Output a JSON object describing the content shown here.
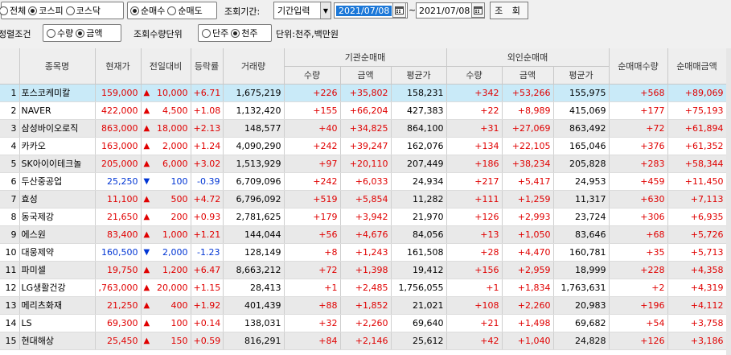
{
  "toolbar": {
    "market_filter": [
      {
        "label": "전체",
        "selected": false
      },
      {
        "label": "코스피",
        "selected": true
      },
      {
        "label": "코스닥",
        "selected": false
      }
    ],
    "trade_type": [
      {
        "label": "순매수",
        "selected": true
      },
      {
        "label": "순매도",
        "selected": false
      }
    ],
    "period_label": "조회기간:",
    "period_select": "기간입력",
    "date_from": "2021/07/08",
    "date_sep": "~",
    "date_to": "2021/07/08",
    "query_button": "조 회",
    "sort_label": "정렬조건",
    "sort_options": [
      {
        "label": "수량",
        "selected": false
      },
      {
        "label": "금액",
        "selected": true
      }
    ],
    "unit_label": "조회수량단위",
    "unit_options": [
      {
        "label": "단주",
        "selected": false
      },
      {
        "label": "천주",
        "selected": true
      }
    ],
    "unit_note": "단위:천주,백만원"
  },
  "table": {
    "group_headers": {
      "institution": "기관순매매",
      "foreign": "외인순매매"
    },
    "headers": {
      "name": "종목명",
      "price": "현재가",
      "change": "전일대비",
      "rate": "등락률",
      "volume": "거래량",
      "inst_qty": "수량",
      "inst_amt": "금액",
      "inst_avg": "평균가",
      "frgn_qty": "수량",
      "frgn_amt": "금액",
      "frgn_avg": "평균가",
      "net_qty": "순매매수량",
      "net_amt": "순매매금액"
    },
    "rows": [
      {
        "idx": "1",
        "name": "포스코케미칼",
        "price": "159,000",
        "dir": "up",
        "change": "10,000",
        "rate": "+6.71",
        "volume": "1,675,219",
        "inst_qty": "+226",
        "inst_amt": "+35,802",
        "inst_avg": "158,231",
        "frgn_qty": "+342",
        "frgn_amt": "+53,266",
        "frgn_avg": "155,975",
        "net_qty": "+568",
        "net_amt": "+89,069"
      },
      {
        "idx": "2",
        "name": "NAVER",
        "price": "422,000",
        "dir": "up",
        "change": "4,500",
        "rate": "+1.08",
        "volume": "1,132,420",
        "inst_qty": "+155",
        "inst_amt": "+66,204",
        "inst_avg": "427,383",
        "frgn_qty": "+22",
        "frgn_amt": "+8,989",
        "frgn_avg": "415,069",
        "net_qty": "+177",
        "net_amt": "+75,193"
      },
      {
        "idx": "3",
        "name": "삼성바이오로직",
        "price": "863,000",
        "dir": "up",
        "change": "18,000",
        "rate": "+2.13",
        "volume": "148,577",
        "inst_qty": "+40",
        "inst_amt": "+34,825",
        "inst_avg": "864,100",
        "frgn_qty": "+31",
        "frgn_amt": "+27,069",
        "frgn_avg": "863,492",
        "net_qty": "+72",
        "net_amt": "+61,894"
      },
      {
        "idx": "4",
        "name": "카카오",
        "price": "163,000",
        "dir": "up",
        "change": "2,000",
        "rate": "+1.24",
        "volume": "4,090,290",
        "inst_qty": "+242",
        "inst_amt": "+39,247",
        "inst_avg": "162,076",
        "frgn_qty": "+134",
        "frgn_amt": "+22,105",
        "frgn_avg": "165,046",
        "net_qty": "+376",
        "net_amt": "+61,352"
      },
      {
        "idx": "5",
        "name": "SK아이이테크놀",
        "price": "205,000",
        "dir": "up",
        "change": "6,000",
        "rate": "+3.02",
        "volume": "1,513,929",
        "inst_qty": "+97",
        "inst_amt": "+20,110",
        "inst_avg": "207,449",
        "frgn_qty": "+186",
        "frgn_amt": "+38,234",
        "frgn_avg": "205,828",
        "net_qty": "+283",
        "net_amt": "+58,344"
      },
      {
        "idx": "6",
        "name": "두산중공업",
        "price": "25,250",
        "dir": "dn",
        "change": "100",
        "rate": "-0.39",
        "volume": "6,709,096",
        "inst_qty": "+242",
        "inst_amt": "+6,033",
        "inst_avg": "24,934",
        "frgn_qty": "+217",
        "frgn_amt": "+5,417",
        "frgn_avg": "24,953",
        "net_qty": "+459",
        "net_amt": "+11,450"
      },
      {
        "idx": "7",
        "name": "효성",
        "price": "11,100",
        "dir": "up",
        "change": "500",
        "rate": "+4.72",
        "volume": "6,796,092",
        "inst_qty": "+519",
        "inst_amt": "+5,854",
        "inst_avg": "11,282",
        "frgn_qty": "+111",
        "frgn_amt": "+1,259",
        "frgn_avg": "11,317",
        "net_qty": "+630",
        "net_amt": "+7,113"
      },
      {
        "idx": "8",
        "name": "동국제강",
        "price": "21,650",
        "dir": "up",
        "change": "200",
        "rate": "+0.93",
        "volume": "2,781,625",
        "inst_qty": "+179",
        "inst_amt": "+3,942",
        "inst_avg": "21,970",
        "frgn_qty": "+126",
        "frgn_amt": "+2,993",
        "frgn_avg": "23,724",
        "net_qty": "+306",
        "net_amt": "+6,935"
      },
      {
        "idx": "9",
        "name": "에스원",
        "price": "83,400",
        "dir": "up",
        "change": "1,000",
        "rate": "+1.21",
        "volume": "144,044",
        "inst_qty": "+56",
        "inst_amt": "+4,676",
        "inst_avg": "84,056",
        "frgn_qty": "+13",
        "frgn_amt": "+1,050",
        "frgn_avg": "83,646",
        "net_qty": "+68",
        "net_amt": "+5,726"
      },
      {
        "idx": "10",
        "name": "대웅제약",
        "price": "160,500",
        "dir": "dn",
        "change": "2,000",
        "rate": "-1.23",
        "volume": "128,149",
        "inst_qty": "+8",
        "inst_amt": "+1,243",
        "inst_avg": "161,508",
        "frgn_qty": "+28",
        "frgn_amt": "+4,470",
        "frgn_avg": "160,781",
        "net_qty": "+35",
        "net_amt": "+5,713"
      },
      {
        "idx": "11",
        "name": "파미셀",
        "price": "19,750",
        "dir": "up",
        "change": "1,200",
        "rate": "+6.47",
        "volume": "8,663,212",
        "inst_qty": "+72",
        "inst_amt": "+1,398",
        "inst_avg": "19,412",
        "frgn_qty": "+156",
        "frgn_amt": "+2,959",
        "frgn_avg": "18,999",
        "net_qty": "+228",
        "net_amt": "+4,358"
      },
      {
        "idx": "12",
        "name": "LG생활건강",
        "price": ",763,000",
        "dir": "up",
        "change": "20,000",
        "rate": "+1.15",
        "volume": "28,413",
        "inst_qty": "+1",
        "inst_amt": "+2,485",
        "inst_avg": "1,756,055",
        "frgn_qty": "+1",
        "frgn_amt": "+1,834",
        "frgn_avg": "1,763,631",
        "net_qty": "+2",
        "net_amt": "+4,319"
      },
      {
        "idx": "13",
        "name": "메리츠화재",
        "price": "21,250",
        "dir": "up",
        "change": "400",
        "rate": "+1.92",
        "volume": "401,439",
        "inst_qty": "+88",
        "inst_amt": "+1,852",
        "inst_avg": "21,021",
        "frgn_qty": "+108",
        "frgn_amt": "+2,260",
        "frgn_avg": "20,983",
        "net_qty": "+196",
        "net_amt": "+4,112"
      },
      {
        "idx": "14",
        "name": "LS",
        "price": "69,300",
        "dir": "up",
        "change": "100",
        "rate": "+0.14",
        "volume": "138,031",
        "inst_qty": "+32",
        "inst_amt": "+2,260",
        "inst_avg": "69,640",
        "frgn_qty": "+21",
        "frgn_amt": "+1,498",
        "frgn_avg": "69,682",
        "net_qty": "+54",
        "net_amt": "+3,758"
      },
      {
        "idx": "15",
        "name": "현대해상",
        "price": "25,450",
        "dir": "up",
        "change": "150",
        "rate": "+0.59",
        "volume": "816,291",
        "inst_qty": "+84",
        "inst_amt": "+2,146",
        "inst_avg": "25,612",
        "frgn_qty": "+42",
        "frgn_amt": "+1,040",
        "frgn_avg": "24,828",
        "net_qty": "+126",
        "net_amt": "+3,186"
      }
    ]
  },
  "colors": {
    "up": "#e00000",
    "down": "#0035d4",
    "selected_row": "#c9eaf8",
    "selected_date": "#1c78d8"
  }
}
